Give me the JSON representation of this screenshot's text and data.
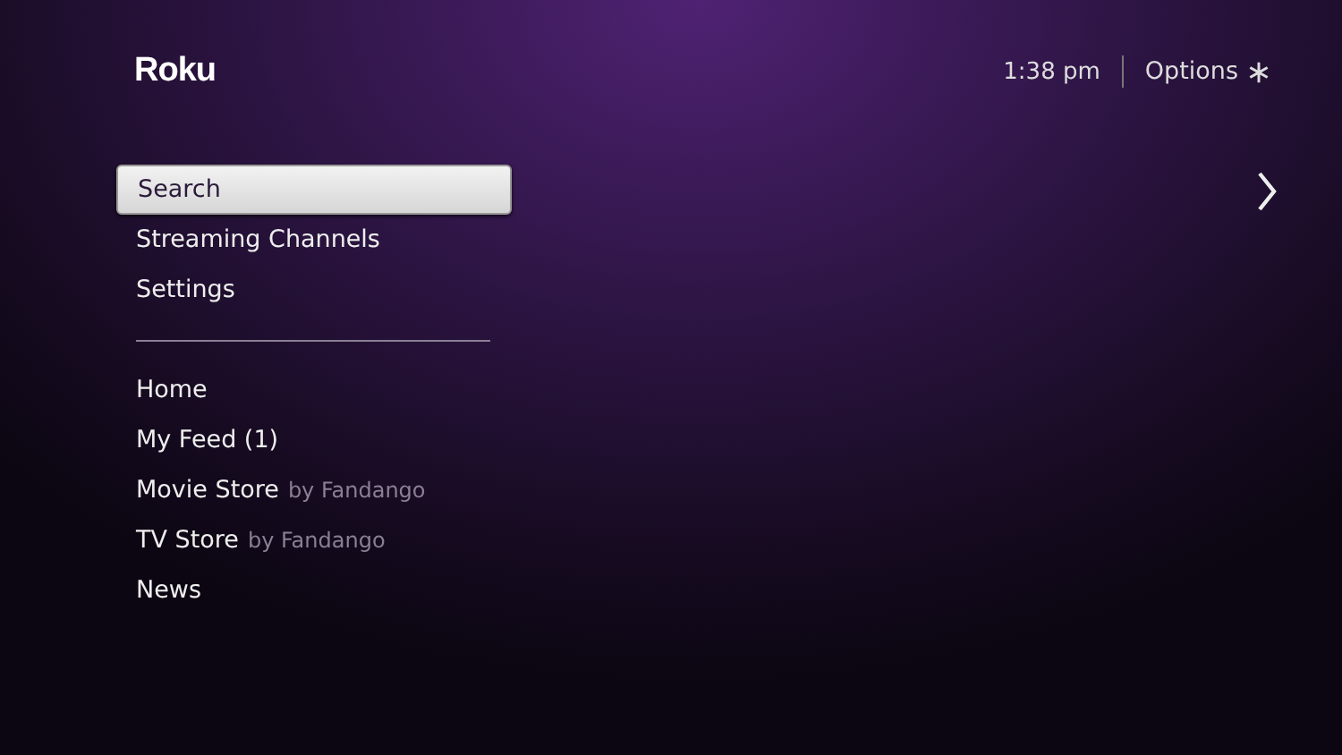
{
  "logo": "Roku",
  "header": {
    "time": "1:38 pm",
    "options": "Options"
  },
  "menu_groups": [
    {
      "items": [
        {
          "label": "Search",
          "selected": true
        },
        {
          "label": "Streaming Channels",
          "selected": false
        },
        {
          "label": "Settings",
          "selected": false
        }
      ]
    },
    {
      "items": [
        {
          "label": "Home",
          "selected": false
        },
        {
          "label": "My Feed (1)",
          "selected": false
        },
        {
          "label": "Movie Store",
          "sublabel": "by Fandango",
          "selected": false
        },
        {
          "label": "TV Store",
          "sublabel": "by Fandango",
          "selected": false
        },
        {
          "label": "News",
          "selected": false
        }
      ]
    }
  ]
}
